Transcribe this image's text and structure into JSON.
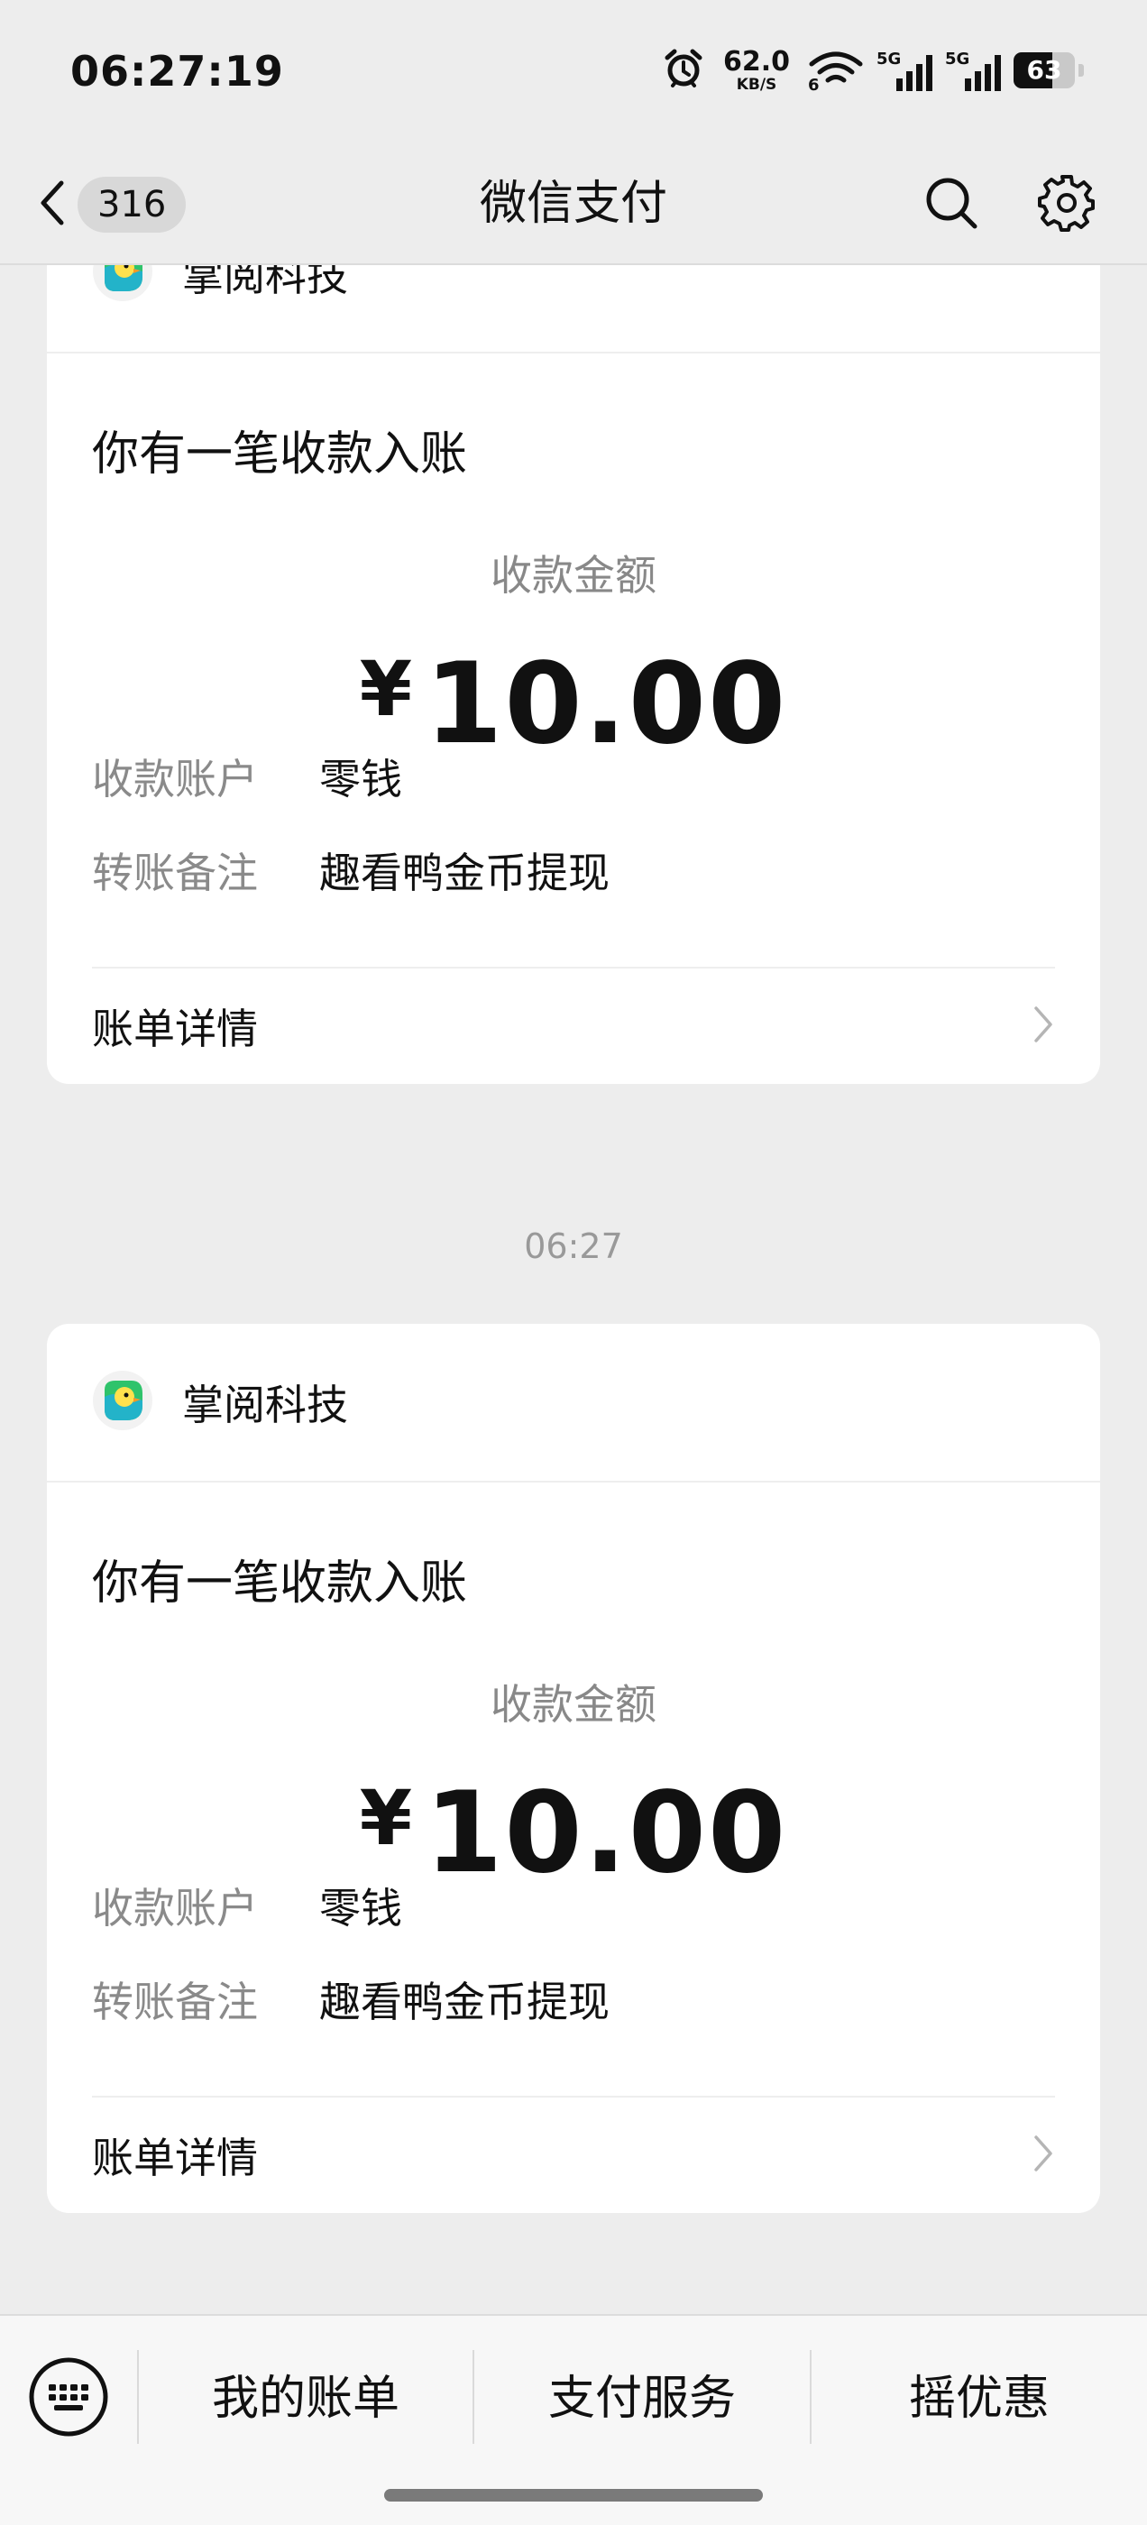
{
  "status_bar": {
    "time": "06:27:19",
    "net_speed_value": "62.0",
    "net_speed_unit": "KB/S",
    "wifi_tag": "6",
    "sim1_tag": "5G",
    "sim2_tag": "5G",
    "battery_level": "63",
    "battery_fraction": 0.63
  },
  "nav": {
    "unread_count": "316",
    "title": "微信支付",
    "icons": {
      "back": "chevron-left-icon",
      "search": "search-icon",
      "settings": "gear-icon"
    }
  },
  "messages": [
    {
      "app_name": "掌阅科技",
      "notice": "你有一笔收款入账",
      "amount_label": "收款金额",
      "currency": "¥",
      "amount": "10.00",
      "rows": [
        {
          "label": "收款账户",
          "value": "零钱"
        },
        {
          "label": "转账备注",
          "value": "趣看鸭金币提现"
        }
      ],
      "detail_label": "账单详情"
    },
    {
      "time": "06:27",
      "app_name": "掌阅科技",
      "notice": "你有一笔收款入账",
      "amount_label": "收款金额",
      "currency": "¥",
      "amount": "10.00",
      "rows": [
        {
          "label": "收款账户",
          "value": "零钱"
        },
        {
          "label": "转账备注",
          "value": "趣看鸭金币提现"
        }
      ],
      "detail_label": "账单详情"
    }
  ],
  "bottom_menu": {
    "keyboard_icon": "keyboard-icon",
    "items": [
      {
        "label": "我的账单"
      },
      {
        "label": "支付服务"
      },
      {
        "label": "摇优惠"
      }
    ]
  },
  "colors": {
    "background": "#ededed",
    "card": "#ffffff",
    "secondary_text": "#888888",
    "logo_green": "#2fc36b",
    "logo_teal": "#23b3c9"
  }
}
